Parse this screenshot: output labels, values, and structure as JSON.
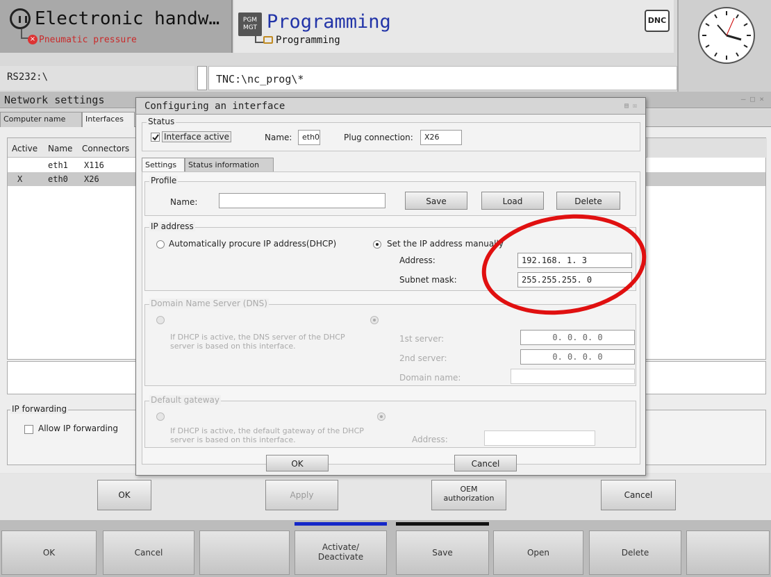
{
  "header": {
    "left_mode": {
      "title": "Electronic handw…",
      "subtitle": "Pneumatic pressure"
    },
    "right_mode": {
      "badge": "PGM MGT",
      "title": "Programming",
      "subtitle": "Programming"
    },
    "dnc_label": "DNC",
    "path_left": "RS232:\\",
    "path_right": "TNC:\\nc_prog\\*"
  },
  "network_window": {
    "title": "Network settings",
    "tabs": [
      "Computer name",
      "Interfaces"
    ],
    "columns": [
      "Active",
      "Name",
      "Connectors"
    ],
    "rows": [
      {
        "active": "",
        "name": "eth1",
        "connector": "X116"
      },
      {
        "active": "X",
        "name": "eth0",
        "connector": "X26"
      }
    ],
    "ip_forwarding": {
      "legend": "IP forwarding",
      "checkbox": "Allow IP forwarding"
    },
    "buttons": {
      "ok": "OK",
      "apply": "Apply",
      "oem": "OEM authorization",
      "cancel": "Cancel"
    }
  },
  "dialog": {
    "title": "Configuring an interface",
    "status": {
      "legend": "Status",
      "interface_active": "Interface active",
      "name_label": "Name:",
      "name_value": "eth0",
      "plug_label": "Plug connection:",
      "plug_value": "X26"
    },
    "tabs": [
      "Settings",
      "Status information"
    ],
    "profile": {
      "legend": "Profile",
      "name_label": "Name:",
      "name_value": "",
      "save": "Save",
      "load": "Load",
      "delete": "Delete"
    },
    "ip": {
      "legend": "IP address",
      "auto": "Automatically procure IP address(DHCP)",
      "manual": "Set the IP address manually",
      "address_label": "Address:",
      "address_value": "192.168.  1.  3",
      "mask_label": "Subnet mask:",
      "mask_value": "255.255.255.  0"
    },
    "dns": {
      "legend": "Domain Name Server (DNS)",
      "note": "If DHCP is active, the DNS server of the DHCP server is based on this interface.",
      "first_label": "1st server:",
      "first_value": "0.  0.  0.  0",
      "second_label": "2nd server:",
      "second_value": "0.  0.  0.  0",
      "domain_label": "Domain name:",
      "domain_value": ""
    },
    "gateway": {
      "legend": "Default gateway",
      "note": "If DHCP is active, the default gateway of the DHCP server is based on this interface.",
      "address_label": "Address:",
      "address_value": ""
    },
    "buttons": {
      "ok": "OK",
      "cancel": "Cancel"
    }
  },
  "softkeys": [
    "OK",
    "Cancel",
    "",
    "Activate/ Deactivate",
    "Save",
    "Open",
    "Delete",
    ""
  ],
  "colors": {
    "highlight": "#e01010",
    "mode_title": "#2234a8",
    "softkey_blue": "#1427c8"
  }
}
